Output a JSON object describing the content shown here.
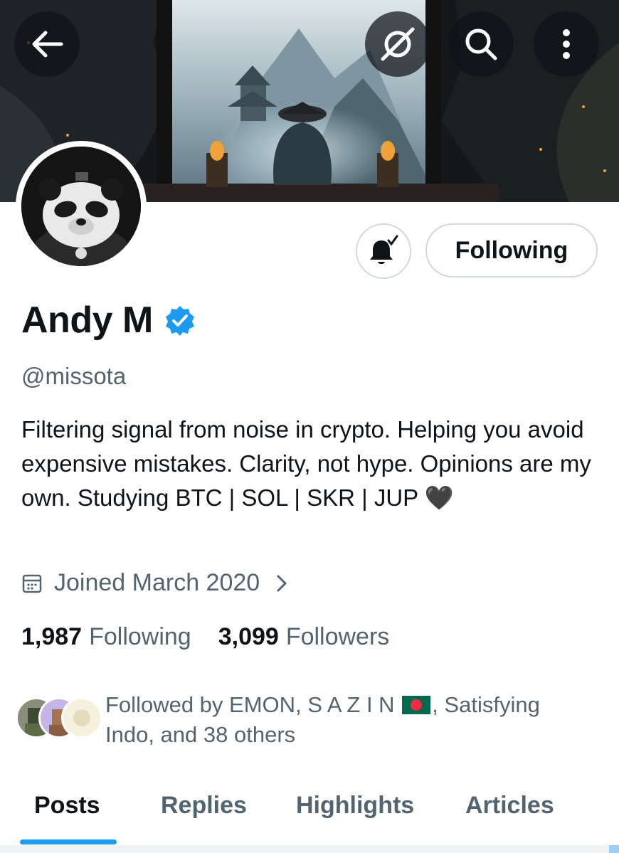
{
  "header": {
    "back_icon": "arrow-left-icon",
    "grok_icon": "grok-icon",
    "search_icon": "search-icon",
    "more_icon": "more-vertical-icon"
  },
  "profile": {
    "name": "Andy M",
    "verified": true,
    "handle": "@missota",
    "bio": "Filtering signal from noise in crypto. Helping you avoid expensive mistakes. Clarity, not hype. Opinions are my own.  Studying BTC | SOL | SKR | JUP 🖤",
    "joined": "Joined March 2020",
    "follow_button": "Following",
    "notification_icon": "bell-check-icon"
  },
  "stats": {
    "following_count": "1,987",
    "following_label": "Following",
    "followers_count": "3,099",
    "followers_label": "Followers"
  },
  "followed_by": {
    "prefix": "Followed by EMON, S A Z I N",
    "suffix": ", Satisfying Indo, and 38 others"
  },
  "tabs": [
    {
      "label": "Posts",
      "active": true
    },
    {
      "label": "Replies",
      "active": false
    },
    {
      "label": "Highlights",
      "active": false
    },
    {
      "label": "Articles",
      "active": false
    }
  ],
  "colors": {
    "accent": "#1d9bf0",
    "text_primary": "#0f1419",
    "text_secondary": "#536471",
    "border": "#cfd9de"
  }
}
